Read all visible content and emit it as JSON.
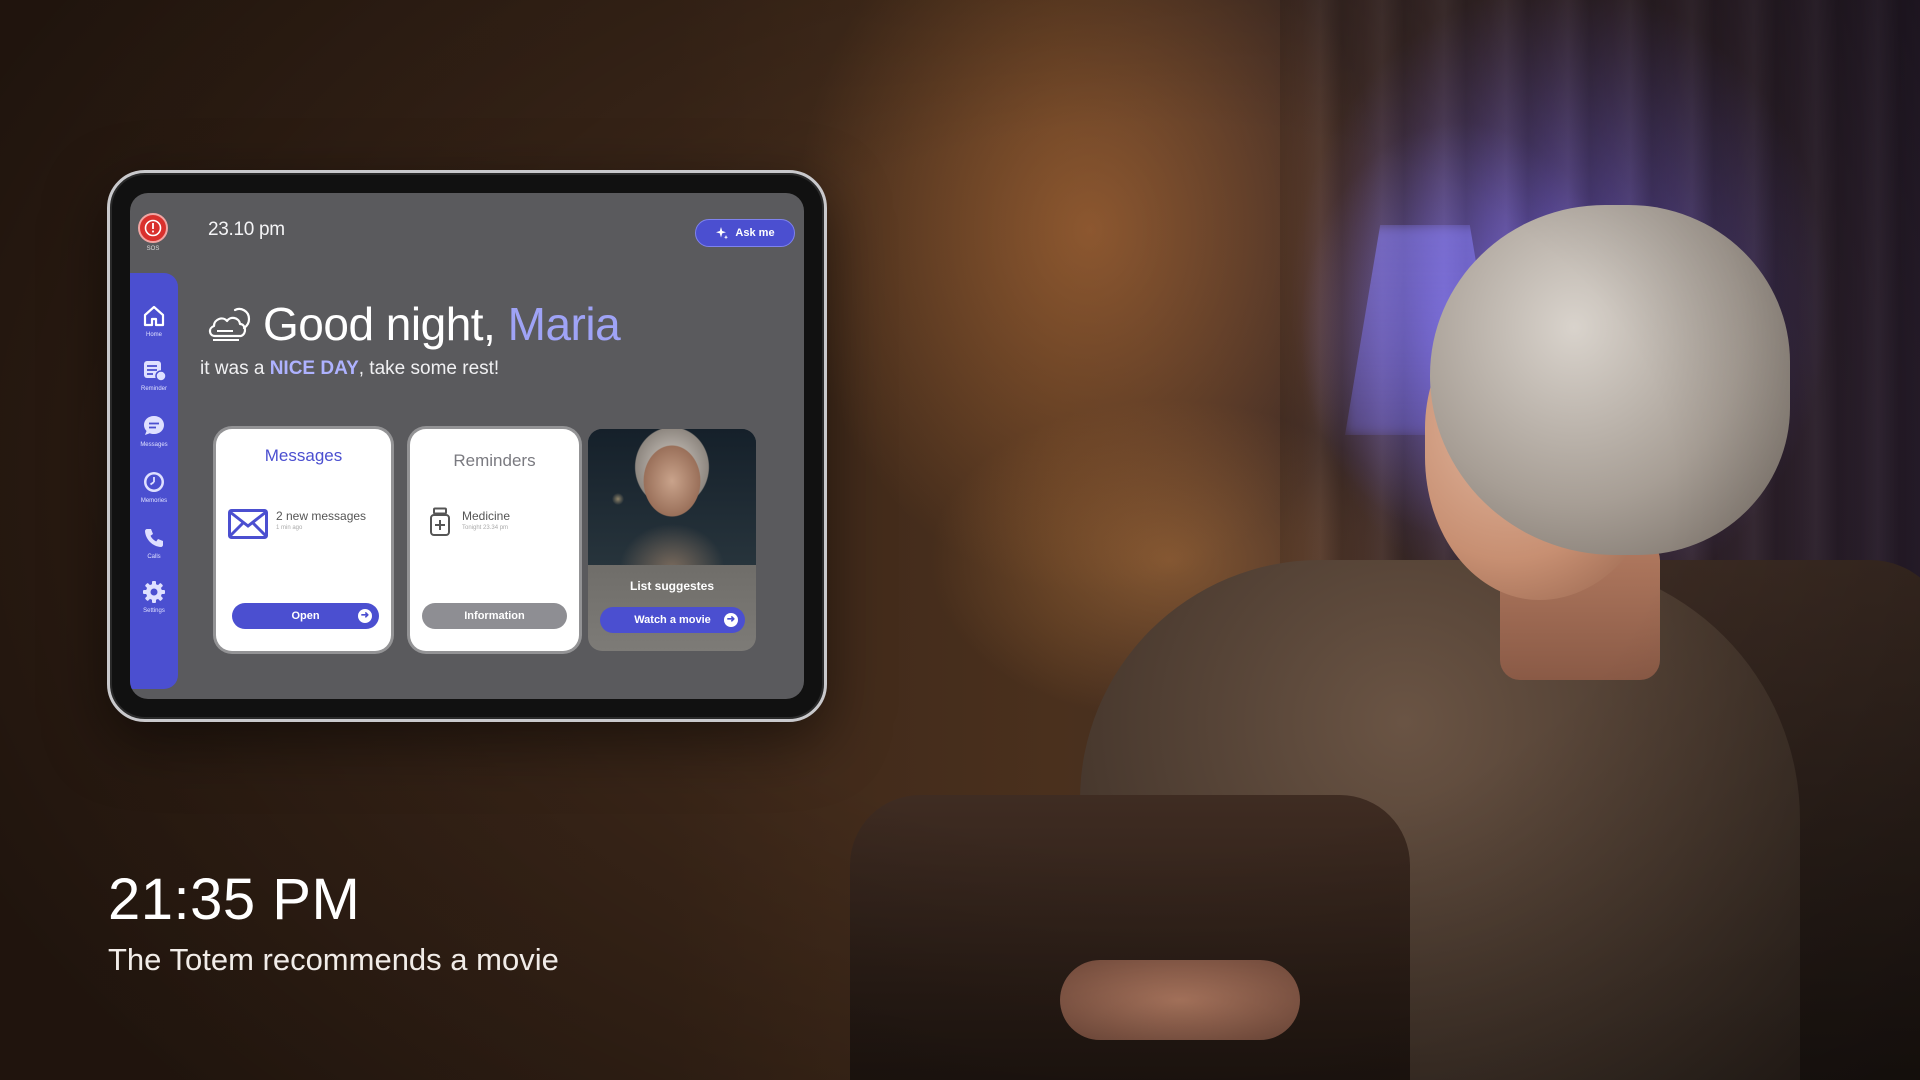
{
  "caption": {
    "time": "21:35 PM",
    "subtitle": "The Totem recommends a movie"
  },
  "tablet": {
    "clock": "23.10 pm",
    "sos_label": "SOS",
    "ask_button": "Ask me",
    "greeting": {
      "prefix": "Good night, ",
      "name": "Maria",
      "sub_before": "it was a ",
      "sub_highlight": "NICE DAY",
      "sub_after": ", take some rest!",
      "icon": "cloud-moon-icon"
    },
    "sidebar": [
      {
        "label": "Home",
        "icon": "home-icon"
      },
      {
        "label": "Reminder",
        "icon": "reminder-icon"
      },
      {
        "label": "Messages",
        "icon": "chat-icon"
      },
      {
        "label": "Memories",
        "icon": "clock-icon"
      },
      {
        "label": "Calls",
        "icon": "phone-icon"
      },
      {
        "label": "Settings",
        "icon": "gear-icon"
      }
    ],
    "cards": {
      "messages": {
        "title": "Messages",
        "item": "2 new messages",
        "item_sub": "1 min ago",
        "button": "Open",
        "icon": "envelope-icon"
      },
      "reminders": {
        "title": "Reminders",
        "item": "Medicine",
        "item_sub": "Tonight 23.34 pm",
        "button": "Information",
        "icon": "medicine-icon"
      },
      "movie": {
        "label": "List suggestes",
        "button": "Watch a movie"
      }
    }
  },
  "colors": {
    "accent": "#4b4fd0",
    "accent_light": "#9fa3f6",
    "sos": "#d9302c",
    "screen_bg": "#5a5a5d",
    "info_button": "#8e8e93"
  }
}
